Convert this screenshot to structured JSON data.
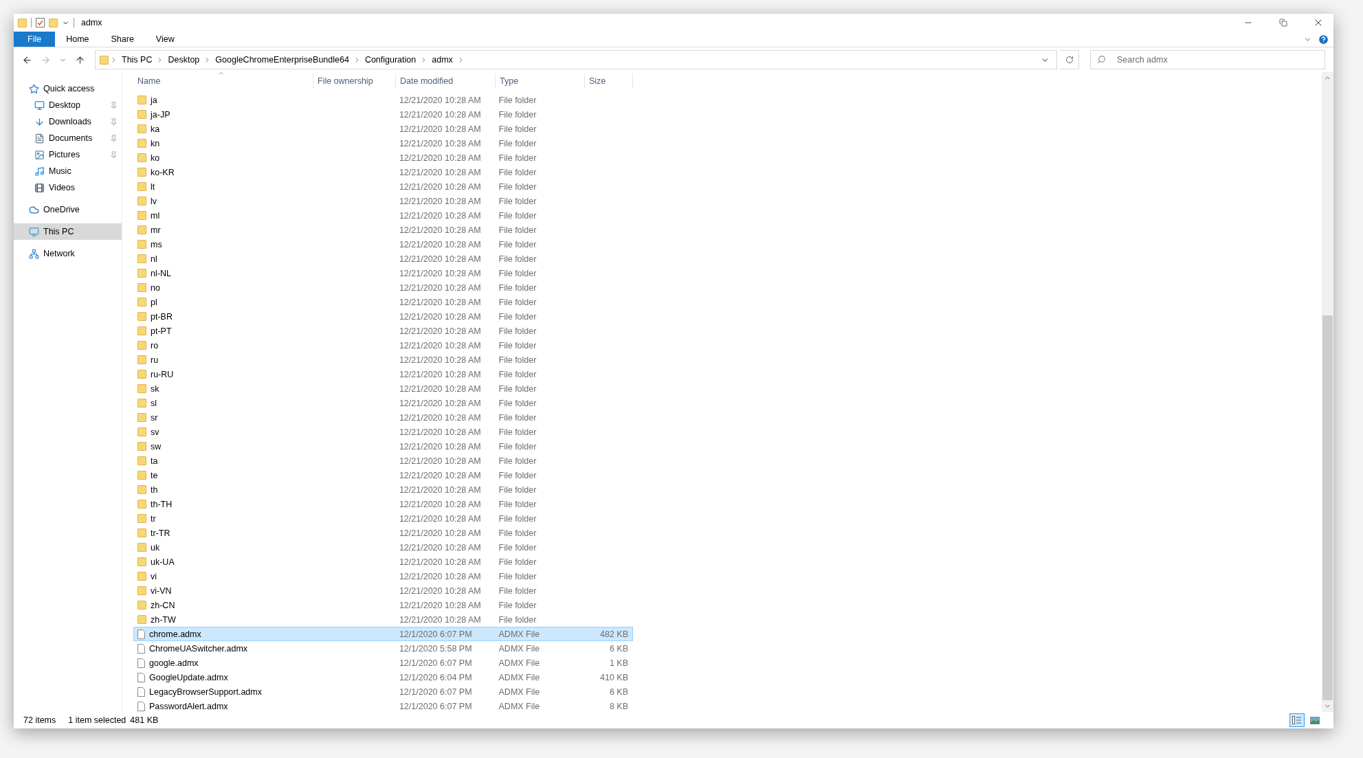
{
  "window": {
    "title": "admx"
  },
  "ribbon_tabs": [
    {
      "label": "File",
      "kind": "file"
    },
    {
      "label": "Home",
      "kind": "tab"
    },
    {
      "label": "Share",
      "kind": "tab"
    },
    {
      "label": "View",
      "kind": "tab"
    }
  ],
  "address_bar": {
    "path": [
      "This PC",
      "Desktop",
      "GoogleChromeEnterpriseBundle64",
      "Configuration",
      "admx"
    ]
  },
  "search": {
    "placeholder": "Search admx"
  },
  "sidebar": {
    "items": [
      {
        "label": "Quick access",
        "kind": "quick-access",
        "pinned": false,
        "selected": false,
        "children": [
          {
            "label": "Desktop",
            "kind": "desktop",
            "pinned": true,
            "selected": false
          },
          {
            "label": "Downloads",
            "kind": "downloads",
            "pinned": true,
            "selected": false
          },
          {
            "label": "Documents",
            "kind": "documents",
            "pinned": true,
            "selected": false
          },
          {
            "label": "Pictures",
            "kind": "pictures",
            "pinned": true,
            "selected": false
          },
          {
            "label": "Music",
            "kind": "music",
            "pinned": false,
            "selected": false
          },
          {
            "label": "Videos",
            "kind": "videos",
            "pinned": false,
            "selected": false
          }
        ]
      },
      {
        "label": "OneDrive",
        "kind": "onedrive",
        "pinned": false,
        "selected": false
      },
      {
        "label": "This PC",
        "kind": "pc",
        "pinned": false,
        "selected": true
      },
      {
        "label": "Network",
        "kind": "network",
        "pinned": false,
        "selected": false
      }
    ]
  },
  "table": {
    "columns": [
      {
        "label": "Name",
        "sorted": true
      },
      {
        "label": "File ownership",
        "sorted": false
      },
      {
        "label": "Date modified",
        "sorted": false
      },
      {
        "label": "Type",
        "sorted": false
      },
      {
        "label": "Size",
        "sorted": false
      }
    ],
    "rows": [
      {
        "kind": "folder",
        "name": "ja",
        "date": "12/21/2020 10:28 AM",
        "type": "File folder",
        "selected": false
      },
      {
        "kind": "folder",
        "name": "ja-JP",
        "date": "12/21/2020 10:28 AM",
        "type": "File folder",
        "selected": false
      },
      {
        "kind": "folder",
        "name": "ka",
        "date": "12/21/2020 10:28 AM",
        "type": "File folder",
        "selected": false
      },
      {
        "kind": "folder",
        "name": "kn",
        "date": "12/21/2020 10:28 AM",
        "type": "File folder",
        "selected": false
      },
      {
        "kind": "folder",
        "name": "ko",
        "date": "12/21/2020 10:28 AM",
        "type": "File folder",
        "selected": false
      },
      {
        "kind": "folder",
        "name": "ko-KR",
        "date": "12/21/2020 10:28 AM",
        "type": "File folder",
        "selected": false
      },
      {
        "kind": "folder",
        "name": "lt",
        "date": "12/21/2020 10:28 AM",
        "type": "File folder",
        "selected": false
      },
      {
        "kind": "folder",
        "name": "lv",
        "date": "12/21/2020 10:28 AM",
        "type": "File folder",
        "selected": false
      },
      {
        "kind": "folder",
        "name": "ml",
        "date": "12/21/2020 10:28 AM",
        "type": "File folder",
        "selected": false
      },
      {
        "kind": "folder",
        "name": "mr",
        "date": "12/21/2020 10:28 AM",
        "type": "File folder",
        "selected": false
      },
      {
        "kind": "folder",
        "name": "ms",
        "date": "12/21/2020 10:28 AM",
        "type": "File folder",
        "selected": false
      },
      {
        "kind": "folder",
        "name": "nl",
        "date": "12/21/2020 10:28 AM",
        "type": "File folder",
        "selected": false
      },
      {
        "kind": "folder",
        "name": "nl-NL",
        "date": "12/21/2020 10:28 AM",
        "type": "File folder",
        "selected": false
      },
      {
        "kind": "folder",
        "name": "no",
        "date": "12/21/2020 10:28 AM",
        "type": "File folder",
        "selected": false
      },
      {
        "kind": "folder",
        "name": "pl",
        "date": "12/21/2020 10:28 AM",
        "type": "File folder",
        "selected": false
      },
      {
        "kind": "folder",
        "name": "pt-BR",
        "date": "12/21/2020 10:28 AM",
        "type": "File folder",
        "selected": false
      },
      {
        "kind": "folder",
        "name": "pt-PT",
        "date": "12/21/2020 10:28 AM",
        "type": "File folder",
        "selected": false
      },
      {
        "kind": "folder",
        "name": "ro",
        "date": "12/21/2020 10:28 AM",
        "type": "File folder",
        "selected": false
      },
      {
        "kind": "folder",
        "name": "ru",
        "date": "12/21/2020 10:28 AM",
        "type": "File folder",
        "selected": false
      },
      {
        "kind": "folder",
        "name": "ru-RU",
        "date": "12/21/2020 10:28 AM",
        "type": "File folder",
        "selected": false
      },
      {
        "kind": "folder",
        "name": "sk",
        "date": "12/21/2020 10:28 AM",
        "type": "File folder",
        "selected": false
      },
      {
        "kind": "folder",
        "name": "sl",
        "date": "12/21/2020 10:28 AM",
        "type": "File folder",
        "selected": false
      },
      {
        "kind": "folder",
        "name": "sr",
        "date": "12/21/2020 10:28 AM",
        "type": "File folder",
        "selected": false
      },
      {
        "kind": "folder",
        "name": "sv",
        "date": "12/21/2020 10:28 AM",
        "type": "File folder",
        "selected": false
      },
      {
        "kind": "folder",
        "name": "sw",
        "date": "12/21/2020 10:28 AM",
        "type": "File folder",
        "selected": false
      },
      {
        "kind": "folder",
        "name": "ta",
        "date": "12/21/2020 10:28 AM",
        "type": "File folder",
        "selected": false
      },
      {
        "kind": "folder",
        "name": "te",
        "date": "12/21/2020 10:28 AM",
        "type": "File folder",
        "selected": false
      },
      {
        "kind": "folder",
        "name": "th",
        "date": "12/21/2020 10:28 AM",
        "type": "File folder",
        "selected": false
      },
      {
        "kind": "folder",
        "name": "th-TH",
        "date": "12/21/2020 10:28 AM",
        "type": "File folder",
        "selected": false
      },
      {
        "kind": "folder",
        "name": "tr",
        "date": "12/21/2020 10:28 AM",
        "type": "File folder",
        "selected": false
      },
      {
        "kind": "folder",
        "name": "tr-TR",
        "date": "12/21/2020 10:28 AM",
        "type": "File folder",
        "selected": false
      },
      {
        "kind": "folder",
        "name": "uk",
        "date": "12/21/2020 10:28 AM",
        "type": "File folder",
        "selected": false
      },
      {
        "kind": "folder",
        "name": "uk-UA",
        "date": "12/21/2020 10:28 AM",
        "type": "File folder",
        "selected": false
      },
      {
        "kind": "folder",
        "name": "vi",
        "date": "12/21/2020 10:28 AM",
        "type": "File folder",
        "selected": false
      },
      {
        "kind": "folder",
        "name": "vi-VN",
        "date": "12/21/2020 10:28 AM",
        "type": "File folder",
        "selected": false
      },
      {
        "kind": "folder",
        "name": "zh-CN",
        "date": "12/21/2020 10:28 AM",
        "type": "File folder",
        "selected": false
      },
      {
        "kind": "folder",
        "name": "zh-TW",
        "date": "12/21/2020 10:28 AM",
        "type": "File folder",
        "selected": false
      },
      {
        "kind": "file",
        "name": "chrome.admx",
        "date": "12/1/2020 6:07 PM",
        "type": "ADMX File",
        "size": "482 KB",
        "selected": true
      },
      {
        "kind": "file",
        "name": "ChromeUASwitcher.admx",
        "date": "12/1/2020 5:58 PM",
        "type": "ADMX File",
        "size": "6 KB",
        "selected": false
      },
      {
        "kind": "file",
        "name": "google.admx",
        "date": "12/1/2020 6:07 PM",
        "type": "ADMX File",
        "size": "1 KB",
        "selected": false
      },
      {
        "kind": "file",
        "name": "GoogleUpdate.admx",
        "date": "12/1/2020 6:04 PM",
        "type": "ADMX File",
        "size": "410 KB",
        "selected": false
      },
      {
        "kind": "file",
        "name": "LegacyBrowserSupport.admx",
        "date": "12/1/2020 6:07 PM",
        "type": "ADMX File",
        "size": "6 KB",
        "selected": false
      },
      {
        "kind": "file",
        "name": "PasswordAlert.admx",
        "date": "12/1/2020 6:07 PM",
        "type": "ADMX File",
        "size": "8 KB",
        "selected": false
      }
    ]
  },
  "status_bar": {
    "item_count": "72 items",
    "selection": "1 item selected",
    "selection_size": "481 KB"
  },
  "view_buttons": [
    {
      "kind": "details",
      "selected": true
    },
    {
      "kind": "large-icons",
      "selected": false
    }
  ]
}
